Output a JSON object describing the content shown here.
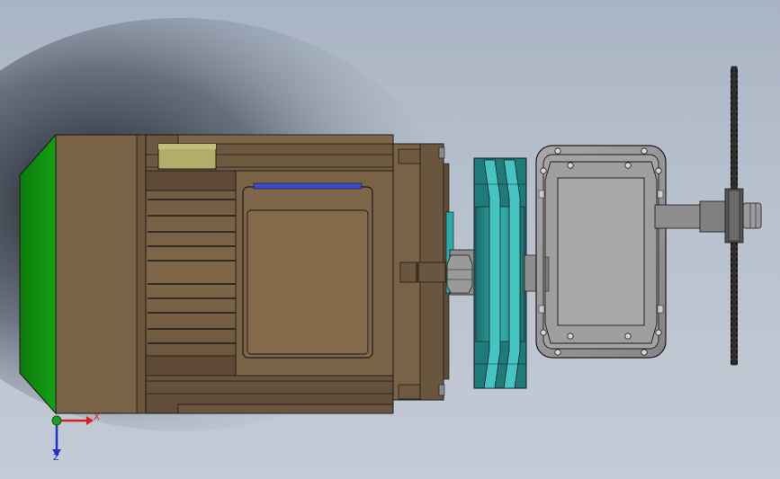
{
  "triad": {
    "x_label": "X",
    "z_label": "Z",
    "x_color": "#d42020",
    "z_color": "#2030c8",
    "y_color": "#18a020"
  },
  "colors": {
    "background_top": "#a9b4c4",
    "background_bottom": "#c4cbd6",
    "motor_body": "#7a6247",
    "motor_dark": "#5e4a35",
    "fan_cover": "#109010",
    "pulley": "#2a8f8f",
    "pulley_light": "#46c8c8",
    "gearbox": "#9a9a9a",
    "gearbox_light": "#c8c8c8",
    "terminal_box": "#b4ad6a",
    "shaft": "#8a8a8a",
    "blade": "#303030",
    "edge": "#1a1a1a"
  }
}
